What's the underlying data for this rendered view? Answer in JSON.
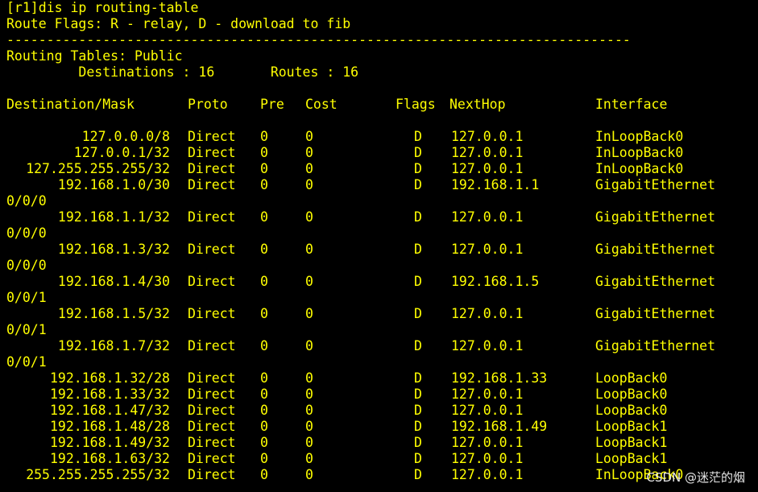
{
  "terminal": {
    "prompt_line": "[r1]dis ip routing-table",
    "flags_line": "Route Flags: R - relay, D - download to fib",
    "separator": "------------------------------------------------------------------------------",
    "tables_line": "Routing Tables: Public",
    "summary_line": "         Destinations : 16       Routes : 16",
    "headers": {
      "destination": "Destination/Mask",
      "proto": "Proto",
      "pre": "Pre",
      "cost": "Cost",
      "flags": "Flags",
      "nexthop": "NextHop",
      "interface": "Interface"
    },
    "routes": [
      {
        "dest": "127.0.0.0/8",
        "proto": "Direct",
        "pre": "0",
        "cost": "0",
        "flags": "D",
        "nexthop": "127.0.0.1",
        "iface": "InLoopBack0",
        "iface_cont": ""
      },
      {
        "dest": "127.0.0.1/32",
        "proto": "Direct",
        "pre": "0",
        "cost": "0",
        "flags": "D",
        "nexthop": "127.0.0.1",
        "iface": "InLoopBack0",
        "iface_cont": ""
      },
      {
        "dest": "127.255.255.255/32",
        "proto": "Direct",
        "pre": "0",
        "cost": "0",
        "flags": "D",
        "nexthop": "127.0.0.1",
        "iface": "InLoopBack0",
        "iface_cont": ""
      },
      {
        "dest": "192.168.1.0/30",
        "proto": "Direct",
        "pre": "0",
        "cost": "0",
        "flags": "D",
        "nexthop": "192.168.1.1",
        "iface": "GigabitEthernet",
        "iface_cont": "0/0/0"
      },
      {
        "dest": "192.168.1.1/32",
        "proto": "Direct",
        "pre": "0",
        "cost": "0",
        "flags": "D",
        "nexthop": "127.0.0.1",
        "iface": "GigabitEthernet",
        "iface_cont": "0/0/0"
      },
      {
        "dest": "192.168.1.3/32",
        "proto": "Direct",
        "pre": "0",
        "cost": "0",
        "flags": "D",
        "nexthop": "127.0.0.1",
        "iface": "GigabitEthernet",
        "iface_cont": "0/0/0"
      },
      {
        "dest": "192.168.1.4/30",
        "proto": "Direct",
        "pre": "0",
        "cost": "0",
        "flags": "D",
        "nexthop": "192.168.1.5",
        "iface": "GigabitEthernet",
        "iface_cont": "0/0/1"
      },
      {
        "dest": "192.168.1.5/32",
        "proto": "Direct",
        "pre": "0",
        "cost": "0",
        "flags": "D",
        "nexthop": "127.0.0.1",
        "iface": "GigabitEthernet",
        "iface_cont": "0/0/1"
      },
      {
        "dest": "192.168.1.7/32",
        "proto": "Direct",
        "pre": "0",
        "cost": "0",
        "flags": "D",
        "nexthop": "127.0.0.1",
        "iface": "GigabitEthernet",
        "iface_cont": "0/0/1"
      },
      {
        "dest": "192.168.1.32/28",
        "proto": "Direct",
        "pre": "0",
        "cost": "0",
        "flags": "D",
        "nexthop": "192.168.1.33",
        "iface": "LoopBack0",
        "iface_cont": ""
      },
      {
        "dest": "192.168.1.33/32",
        "proto": "Direct",
        "pre": "0",
        "cost": "0",
        "flags": "D",
        "nexthop": "127.0.0.1",
        "iface": "LoopBack0",
        "iface_cont": ""
      },
      {
        "dest": "192.168.1.47/32",
        "proto": "Direct",
        "pre": "0",
        "cost": "0",
        "flags": "D",
        "nexthop": "127.0.0.1",
        "iface": "LoopBack0",
        "iface_cont": ""
      },
      {
        "dest": "192.168.1.48/28",
        "proto": "Direct",
        "pre": "0",
        "cost": "0",
        "flags": "D",
        "nexthop": "192.168.1.49",
        "iface": "LoopBack1",
        "iface_cont": ""
      },
      {
        "dest": "192.168.1.49/32",
        "proto": "Direct",
        "pre": "0",
        "cost": "0",
        "flags": "D",
        "nexthop": "127.0.0.1",
        "iface": "LoopBack1",
        "iface_cont": ""
      },
      {
        "dest": "192.168.1.63/32",
        "proto": "Direct",
        "pre": "0",
        "cost": "0",
        "flags": "D",
        "nexthop": "127.0.0.1",
        "iface": "LoopBack1",
        "iface_cont": ""
      },
      {
        "dest": "255.255.255.255/32",
        "proto": "Direct",
        "pre": "0",
        "cost": "0",
        "flags": "D",
        "nexthop": "127.0.0.1",
        "iface": "InLoopBack0",
        "iface_cont": ""
      }
    ]
  },
  "watermark": "CSDN @迷茫的烟",
  "colors": {
    "background": "#000000",
    "text": "#ffff00",
    "watermark": "#e6e6e6"
  }
}
